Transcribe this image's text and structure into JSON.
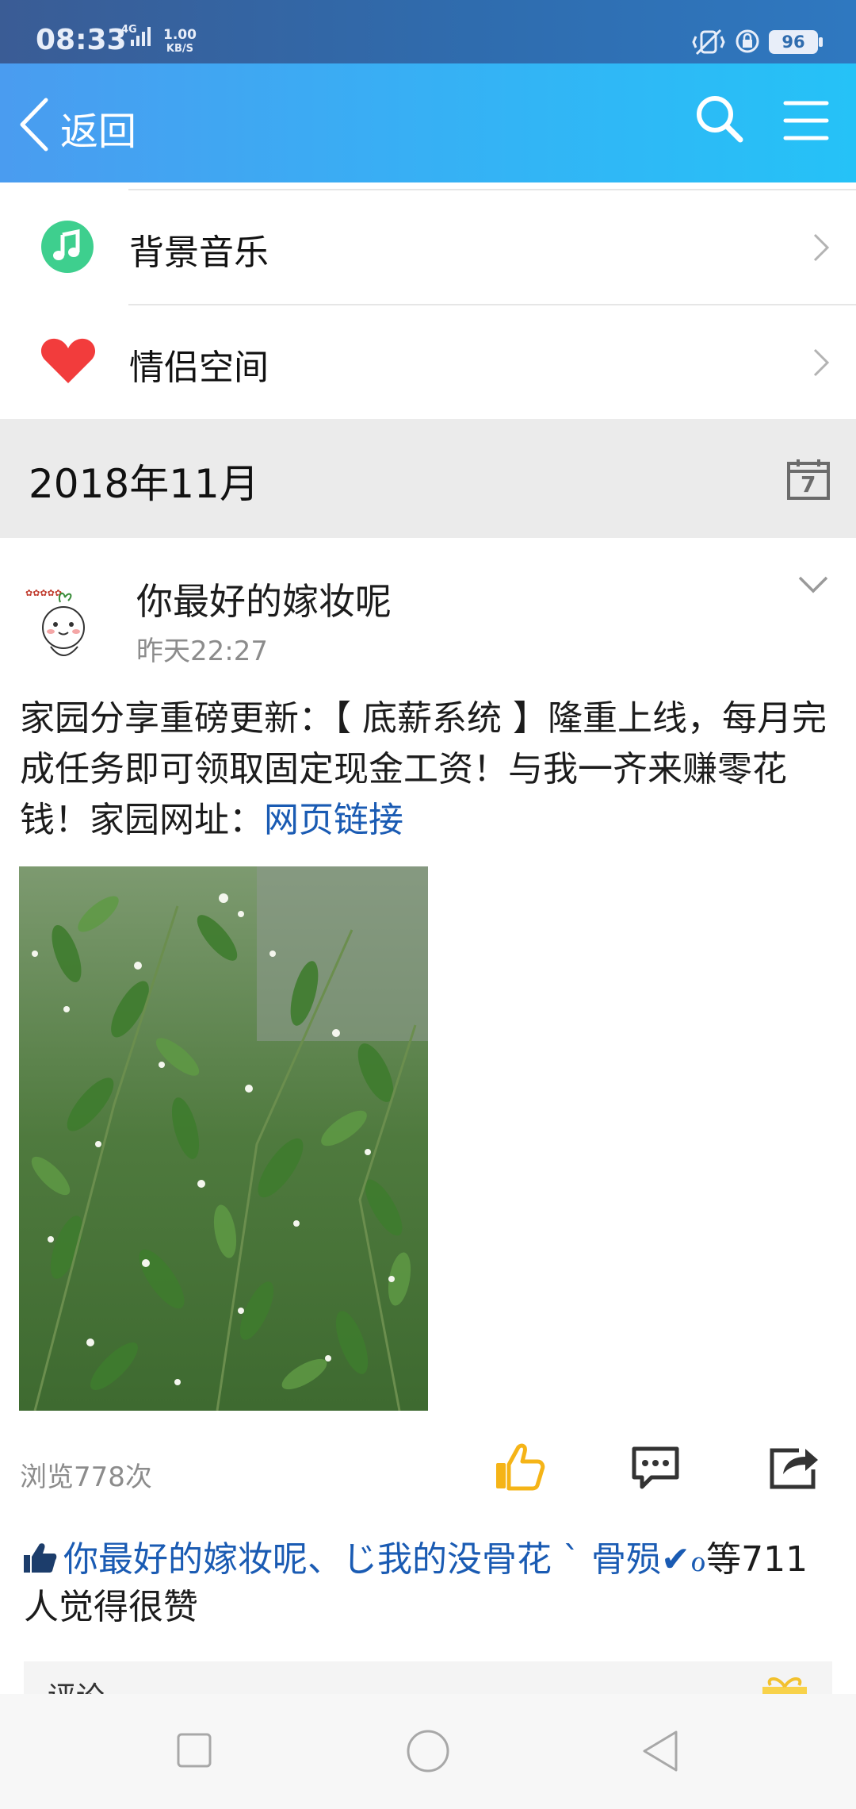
{
  "status_bar": {
    "time": "08:33",
    "network": "4G",
    "speed_value": "1.00",
    "speed_unit": "KB/S",
    "battery": "96"
  },
  "header": {
    "back_label": "返回"
  },
  "menu": {
    "items": [
      {
        "label": "背景音乐",
        "icon": "music-icon"
      },
      {
        "label": "情侣空间",
        "icon": "heart-icon"
      }
    ]
  },
  "month_bar": {
    "label": "2018年11月",
    "calendar_day": "7"
  },
  "post": {
    "author": "你最好的嫁妆呢",
    "time": "昨天22:27",
    "text": "家园分享重磅更新：【 底薪系统 】隆重上线，每月完成任务即可领取固定现金工资！与我一齐来赚零花钱！家园网址：",
    "link_text": "网页链接",
    "views": "浏览778次",
    "likes_names": "你最好的嫁妆呢、じ我的没骨花 ˋ 骨殒✔ℴ",
    "likes_suffix": "等711人觉得很赞",
    "comment_label": "评论"
  },
  "colors": {
    "accent_blue": "#33b4f5",
    "link_blue": "#1a5bb3",
    "like_orange": "#f5b417",
    "music_green": "#3ecf8e",
    "heart_red": "#f23c3c"
  }
}
